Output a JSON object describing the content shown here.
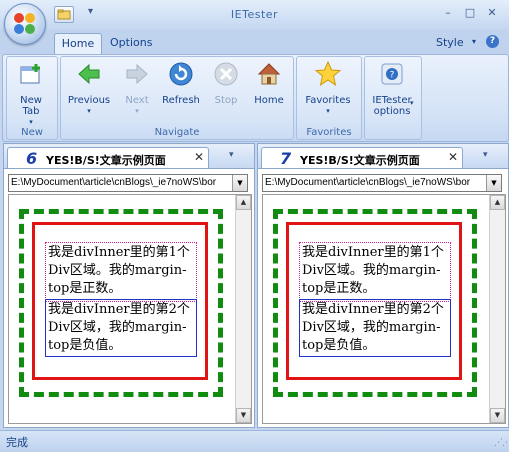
{
  "window": {
    "title": "IETester",
    "minimize": "–",
    "maximize": "□",
    "close": "✕"
  },
  "quick_access": {
    "dropdown": "▾"
  },
  "ribbon_tabs": {
    "home": "Home",
    "options": "Options",
    "style": "Style",
    "style_arrow": "▾",
    "help": "?"
  },
  "groups": {
    "new": {
      "label": "New",
      "buttons": [
        {
          "label": "New\nTab",
          "dropdown": "▾",
          "icon": "new-tab-icon"
        }
      ]
    },
    "navigate": {
      "label": "Navigate",
      "buttons": [
        {
          "label": "Previous",
          "dropdown": "▾",
          "icon": "back-arrow-icon",
          "enabled": true
        },
        {
          "label": "Next",
          "dropdown": "▾",
          "icon": "forward-arrow-icon",
          "enabled": false
        },
        {
          "label": "Refresh",
          "icon": "refresh-icon",
          "enabled": true
        },
        {
          "label": "Stop",
          "icon": "stop-icon",
          "enabled": false
        },
        {
          "label": "Home",
          "icon": "home-icon",
          "enabled": true
        }
      ]
    },
    "favorites": {
      "label": "Favorites",
      "buttons": [
        {
          "label": "Favorites",
          "dropdown": "▾",
          "icon": "star-icon"
        }
      ]
    },
    "ietester": {
      "buttons": [
        {
          "label": "IETester\noptions",
          "dropdown": "▾",
          "icon": "options-icon"
        }
      ]
    }
  },
  "panes": [
    {
      "version": "6",
      "tab_title": "YES!B/S!文章示例页面",
      "close": "✕",
      "dropdown": "▾",
      "address": "E:\\MyDocument\\article\\cnBlogs\\_ie7noWS\\bor",
      "content": {
        "div1": "我是divInner里的第1个Div区域。我的margin-top是正数。",
        "div2": "我是divInner里的第2个Div区域，我的margin-top是负值。"
      }
    },
    {
      "version": "7",
      "tab_title": "YES!B/S!文章示例页面",
      "close": "✕",
      "dropdown": "▾",
      "address": "E:\\MyDocument\\article\\cnBlogs\\_ie7noWS\\bor",
      "content": {
        "div1": "我是divInner里的第1个Div区域。我的margin-top是正数。",
        "div2": "我是divInner里的第2个Div区域，我的margin-top是负值。"
      }
    }
  ],
  "status": {
    "text": "完成",
    "grip": "⋰⋰"
  },
  "colors": {
    "accent": "#15428b",
    "ribbon_bg": "#c5d6ee",
    "dashed_border": "#118c11",
    "red_border": "#e01414",
    "blue_border": "#2032c8",
    "dotted_border": "#d0209a"
  }
}
